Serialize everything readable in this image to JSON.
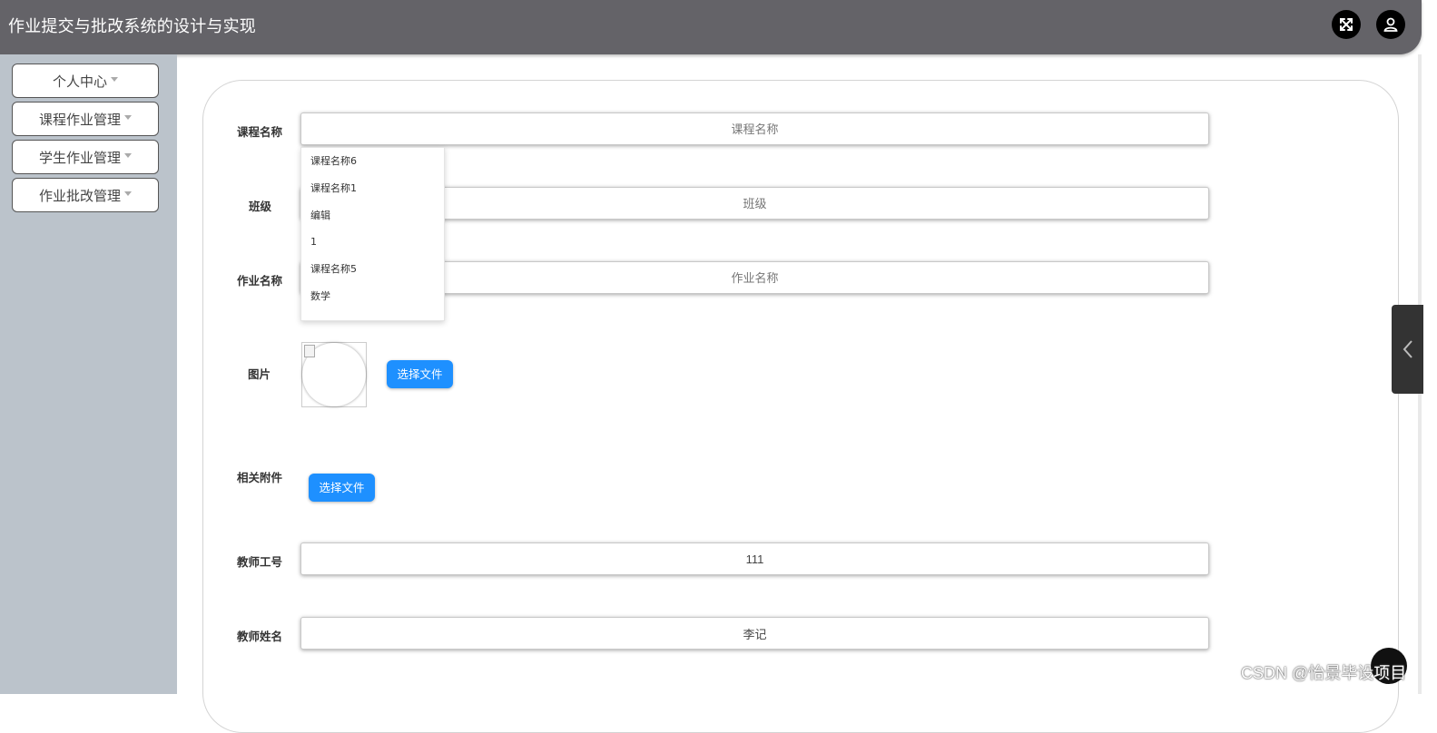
{
  "header": {
    "title": "作业提交与批改系统的设计与实现"
  },
  "sidebar": {
    "items": [
      {
        "label": "个人中心"
      },
      {
        "label": "课程作业管理"
      },
      {
        "label": "学生作业管理"
      },
      {
        "label": "作业批改管理"
      }
    ]
  },
  "form": {
    "course_name": {
      "label": "课程名称",
      "placeholder": "课程名称",
      "value": ""
    },
    "class": {
      "label": "班级",
      "placeholder": "班级",
      "value": ""
    },
    "homework_name": {
      "label": "作业名称",
      "placeholder": "作业名称",
      "value": ""
    },
    "image": {
      "label": "图片",
      "button": "选择文件"
    },
    "attachment": {
      "label": "相关附件",
      "button": "选择文件"
    },
    "teacher_id": {
      "label": "教师工号",
      "value": "111"
    },
    "teacher_name": {
      "label": "教师姓名",
      "value": "李记"
    }
  },
  "autocomplete": {
    "options": [
      "课程名称6",
      "课程名称1",
      "编辑",
      "1",
      "课程名称5",
      "数学"
    ]
  },
  "watermark": "CSDN @怡景毕设项目",
  "colors": {
    "topbar": "#646368",
    "sidebar": "#bbc3cb",
    "primary_button": "#1e90ff"
  }
}
